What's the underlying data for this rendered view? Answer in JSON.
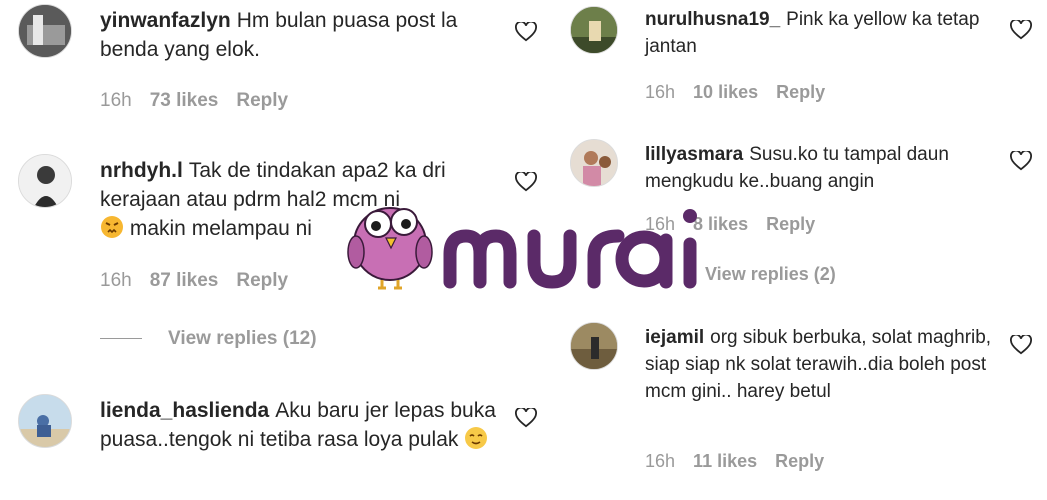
{
  "comments": [
    {
      "username": "yinwanfazlyn",
      "text": "Hm bulan puasa post la benda yang elok.",
      "time": "16h",
      "likes": "73 likes",
      "reply": "Reply"
    },
    {
      "username": "nrhdyh.l",
      "text": "Tak de tindakan apa2 ka dri kerajaan atau pdrm hal2 mcm ni",
      "text2": "makin melampau ni",
      "time": "16h",
      "likes": "87 likes",
      "reply": "Reply",
      "view_replies": "View replies (12)"
    },
    {
      "username": "lienda_haslienda",
      "text": "Aku baru jer lepas buka puasa..tengok ni tetiba rasa loya pulak",
      "time": "",
      "likes": "",
      "reply": ""
    },
    {
      "username": "nurulhusna19_",
      "text": "Pink ka yellow ka tetap jantan",
      "time": "16h",
      "likes": "10 likes",
      "reply": "Reply"
    },
    {
      "username": "lillyasmara",
      "text": "Susu.ko tu tampal daun mengkudu ke..buang angin",
      "time": "16h",
      "likes": "8 likes",
      "reply": "Reply",
      "view_replies": "View replies (2)"
    },
    {
      "username": "iejamil",
      "text": "org sibuk berbuka, solat maghrib, siap siap nk solat terawih..dia boleh post mcm gini.. harey betul",
      "time": "16h",
      "likes": "11 likes",
      "reply": "Reply"
    }
  ],
  "watermark": {
    "brand": "murai"
  },
  "colors": {
    "text": "#262626",
    "meta": "#9a9a9a",
    "brand": "#5b2a68",
    "bird": "#c86fb4"
  }
}
